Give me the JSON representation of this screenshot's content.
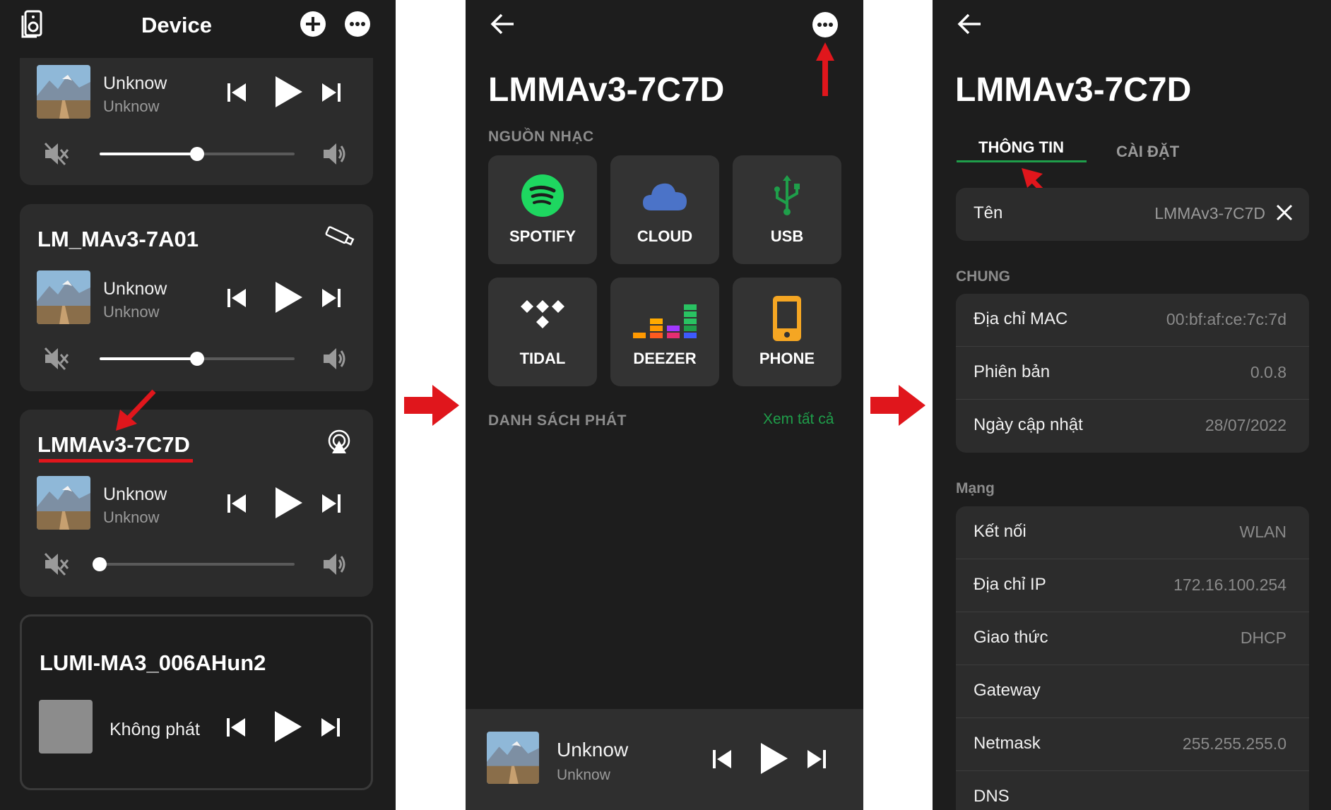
{
  "panel1": {
    "header_title": "Device",
    "cards": [
      {
        "name": "",
        "track": "Unknow",
        "artist": "Unknow",
        "volume": 0.5,
        "badge": ""
      },
      {
        "name": "LM_MAv3-7A01",
        "track": "Unknow",
        "artist": "Unknow",
        "volume": 0.5,
        "badge": "usb-drive-icon"
      },
      {
        "name": "LMMAv3-7C7D",
        "track": "Unknow",
        "artist": "Unknow",
        "volume": 0.0,
        "badge": "airplay-icon"
      },
      {
        "name": "LUMI-MA3_006AHun2",
        "track": "Không phát",
        "artist": "",
        "volume": null,
        "badge": ""
      }
    ]
  },
  "panel2": {
    "title": "LMMAv3-7C7D",
    "sources_heading": "NGUỒN NHẠC",
    "sources": [
      {
        "label": "SPOTIFY",
        "icon": "spotify-icon"
      },
      {
        "label": "CLOUD",
        "icon": "cloud-icon"
      },
      {
        "label": "USB",
        "icon": "usb-icon"
      },
      {
        "label": "TIDAL",
        "icon": "tidal-icon"
      },
      {
        "label": "DEEZER",
        "icon": "deezer-icon"
      },
      {
        "label": "PHONE",
        "icon": "phone-icon"
      }
    ],
    "playlist_heading": "DANH SÁCH PHÁT",
    "see_all": "Xem tất cả",
    "mini_player": {
      "track": "Unknow",
      "artist": "Unknow"
    }
  },
  "panel3": {
    "title": "LMMAv3-7C7D",
    "tabs": {
      "info": "THÔNG TIN",
      "settings": "CÀI ĐẶT"
    },
    "name_row": {
      "label": "Tên",
      "value": "LMMAv3-7C7D"
    },
    "general_heading": "CHUNG",
    "general": [
      {
        "label": "Địa chỉ MAC",
        "value": "00:bf:af:ce:7c:7d"
      },
      {
        "label": "Phiên bản",
        "value": "0.0.8"
      },
      {
        "label": "Ngày cập nhật",
        "value": "28/07/2022"
      }
    ],
    "network_heading": "Mạng",
    "network": [
      {
        "label": "Kết nối",
        "value": "WLAN"
      },
      {
        "label": "Địa chỉ IP",
        "value": "172.16.100.254"
      },
      {
        "label": "Giao thức",
        "value": "DHCP"
      },
      {
        "label": "Gateway",
        "value": ""
      },
      {
        "label": "Netmask",
        "value": "255.255.255.0"
      },
      {
        "label": "DNS",
        "value": ""
      }
    ]
  },
  "colors": {
    "accent_green": "#1f9e4a",
    "annotation_red": "#e0161c",
    "panel_bg": "#1d1d1d",
    "card_bg": "#2c2c2c"
  }
}
